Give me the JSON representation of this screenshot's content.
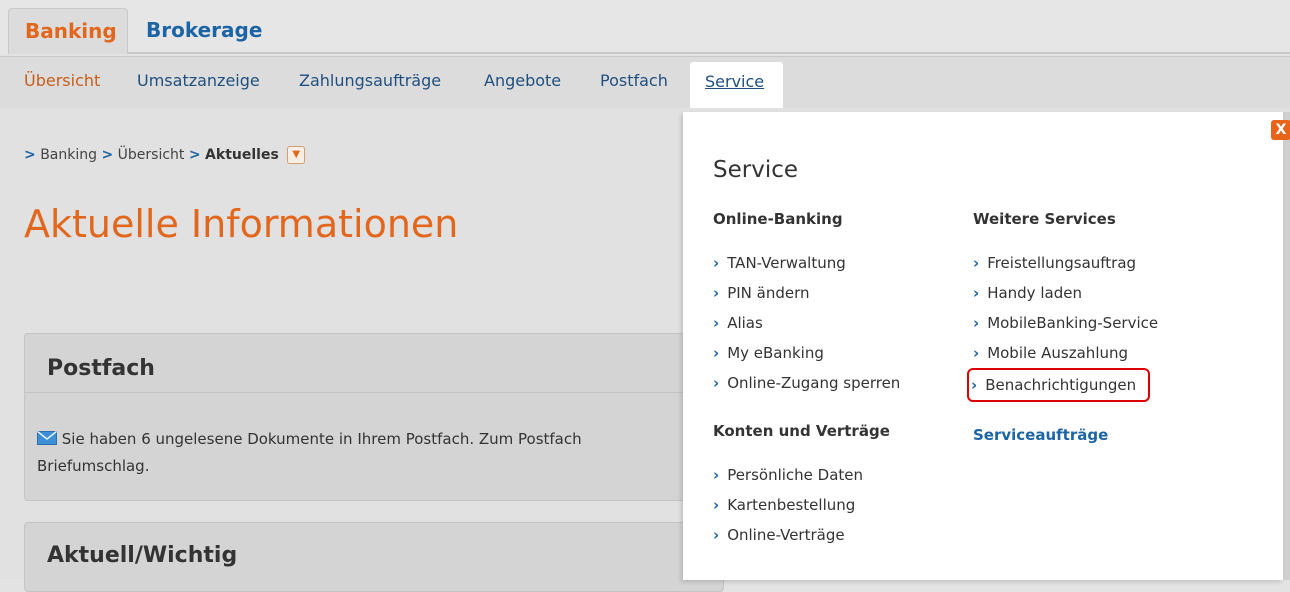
{
  "top_tabs": [
    "Banking",
    "Brokerage"
  ],
  "nav": {
    "items": [
      "Übersicht",
      "Umsatzanzeige",
      "Zahlungsaufträge",
      "Angebote",
      "Postfach",
      "Service"
    ]
  },
  "breadcrumb": {
    "items": [
      "Banking",
      "Übersicht",
      "Aktuelles"
    ],
    "separator": ">",
    "dropdown_icon": "chevron-down-icon"
  },
  "page": {
    "title": "Aktuelle Informationen"
  },
  "postfach": {
    "title": "Postfach",
    "message_line1": "Sie haben 6 ungelesene Dokumente in Ihrem Postfach. Zum Postfach",
    "message_line2": "Briefumschlag."
  },
  "aktuell": {
    "title": "Aktuell/Wichtig"
  },
  "service_menu": {
    "title": "Service",
    "close_label": "X",
    "online_banking": {
      "heading": "Online-Banking",
      "items": [
        "TAN-Verwaltung",
        "PIN ändern",
        "Alias",
        "My eBanking",
        "Online-Zugang sperren"
      ]
    },
    "konten": {
      "heading": "Konten und Verträge",
      "items": [
        "Persönliche Daten",
        "Kartenbestellung",
        "Online-Verträge"
      ]
    },
    "weitere": {
      "heading": "Weitere Services",
      "items": [
        "Freistellungsauftrag",
        "Handy laden",
        "MobileBanking-Service",
        "Mobile Auszahlung",
        "Benachrichtigungen"
      ]
    },
    "serviceauftraege": "Serviceaufträge"
  },
  "colors": {
    "accent_orange": "#e2671d",
    "link_blue": "#1c64a4",
    "highlight_red": "#dd0000"
  }
}
